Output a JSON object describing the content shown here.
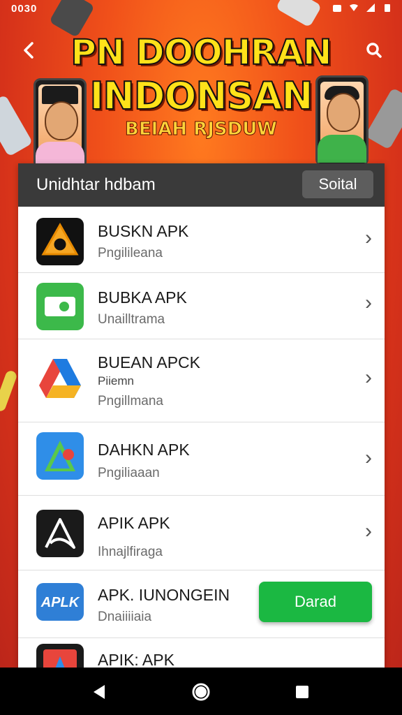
{
  "status_bar": {
    "time": "0030"
  },
  "banner": {
    "title_line1": "PN DOOHRAN",
    "title_line2": "INDONSAN",
    "subtitle": "BEIAH RJSDUW"
  },
  "list": {
    "header_title": "Unidhtar hdbam",
    "sort_label": "Soital",
    "apps": [
      {
        "name": "BUSKN APK",
        "category": "Pngilileana"
      },
      {
        "name": "BUBKA APK",
        "category": "Unailltrama"
      },
      {
        "name": "BUEAN APCK",
        "subtitle": "Piiemn",
        "category": "Pngillmana"
      },
      {
        "name": "DAHKN APK",
        "category": "Pngiliaaan"
      },
      {
        "name": "APIK APK",
        "category": "Ihnajlfiraga"
      },
      {
        "name": "APK. IUNONGEIN",
        "category": "Dnaiiiiaia",
        "button": "Darad"
      },
      {
        "name": "APIK: APK"
      }
    ]
  },
  "icons": {
    "back": "arrow-left-icon",
    "search": "search-icon",
    "chevron": "chevron-right-icon"
  },
  "colors": {
    "background": "#e84a1a",
    "header": "#3a3a3a",
    "download_button": "#1bb842",
    "banner_text": "#ffe21a"
  }
}
